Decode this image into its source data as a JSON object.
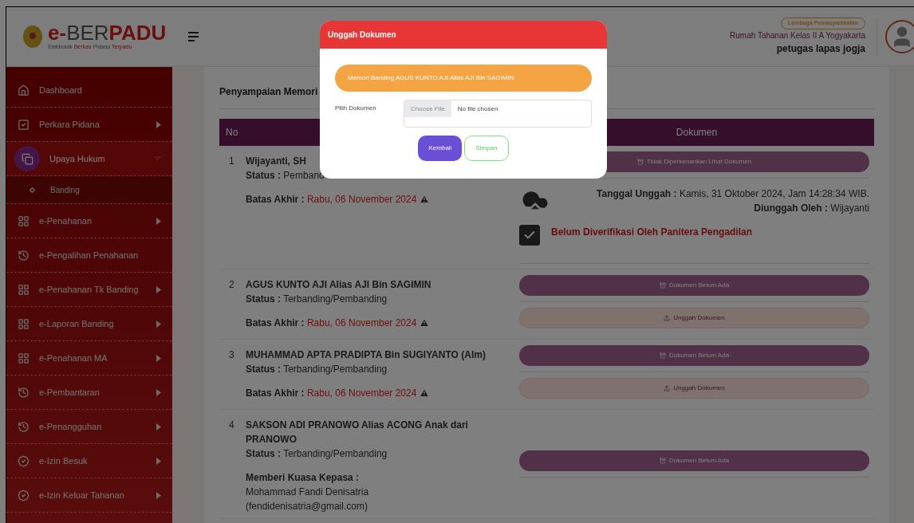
{
  "logo": {
    "title": [
      {
        "text": "e-",
        "kind": "accent"
      },
      {
        "text": "BER",
        "kind": "plain"
      },
      {
        "text": "PADU",
        "kind": "accent"
      }
    ],
    "subtitle": [
      {
        "text": "Elektronik ",
        "kind": "plain"
      },
      {
        "text": "Berkas ",
        "kind": "accent"
      },
      {
        "text": "Pidana ",
        "kind": "plain"
      },
      {
        "text": "Terpadu",
        "kind": "accent"
      }
    ]
  },
  "header": {
    "badge": "Lembaga Pemasyarakatan",
    "institution": "Rumah Tahanan Kelas II A Yogyakarta",
    "user": "petugas lapas jogja"
  },
  "sidebar": {
    "items": [
      {
        "label": "Dashboard",
        "kind": "home",
        "has_arrow": false,
        "selected": false
      },
      {
        "label": "Perkara Pidana",
        "kind": "check",
        "has_arrow": true,
        "selected": false
      },
      {
        "label": "Upaya Hukum",
        "kind": "copy",
        "has_arrow": true,
        "selected": true,
        "expanded": true,
        "children": [
          {
            "label": "Banding",
            "selected": false
          }
        ]
      },
      {
        "label": "e-Penahanan",
        "kind": "grid",
        "has_arrow": true,
        "selected": false
      },
      {
        "label": "e-Pengalihan Penahanan",
        "kind": "history",
        "has_arrow": false,
        "selected": false
      },
      {
        "label": "e-Penahanan Tk Banding",
        "kind": "grid",
        "has_arrow": true,
        "selected": false
      },
      {
        "label": "e-Laporan Banding",
        "kind": "grid",
        "has_arrow": true,
        "selected": false
      },
      {
        "label": "e-Penahanan MA",
        "kind": "grid",
        "has_arrow": true,
        "selected": false
      },
      {
        "label": "e-Pembantaran",
        "kind": "history",
        "has_arrow": true,
        "selected": false
      },
      {
        "label": "e-Penangguhan",
        "kind": "history",
        "has_arrow": true,
        "selected": false
      },
      {
        "label": "e-Izin Besuk",
        "kind": "badge",
        "has_arrow": true,
        "selected": false
      },
      {
        "label": "e-Izin Keluar Tahanan",
        "kind": "badge",
        "has_arrow": true,
        "selected": false
      }
    ]
  },
  "page_title": "Penyampaian Memori",
  "table": {
    "columns": [
      "No",
      "Dokumen"
    ],
    "rows": [
      {
        "no": "1",
        "name": "Wijayanti, SH",
        "details": [
          {
            "kind": "status",
            "label": "Status :",
            "value": "Pemband"
          },
          {
            "kind": "deadline",
            "label": "Batas Akhir :",
            "value": "Rabu, 06 November 2024"
          }
        ],
        "documents": [
          {
            "kind": "view",
            "label": "Tidak Diperkenankan Lihat Dokumen"
          },
          {
            "kind": "upload_info",
            "date_label": "Tanggal Unggah :",
            "date": "Kamis, 31 Oktober 2024, Jam 14:28:34 WIB.",
            "by_label": "Diunggah Oleh :",
            "by": "Wijayanti"
          },
          {
            "kind": "verification",
            "label": "Belum Diverifikasi Oleh Panitera Pengadilan"
          }
        ]
      },
      {
        "no": "2",
        "name": "AGUS KUNTO AJI Alias AJI Bin SAGIMIN",
        "details": [
          {
            "kind": "status",
            "label": "Status :",
            "value": "Terbanding/Pembanding"
          },
          {
            "kind": "deadline",
            "label": "Batas Akhir :",
            "value": "Rabu, 06 November 2024"
          }
        ],
        "documents": [
          {
            "kind": "view",
            "label": "Dokumen Belum Ada"
          },
          {
            "kind": "upload",
            "label": "Unggah Dokumen"
          }
        ]
      },
      {
        "no": "3",
        "name": "MUHAMMAD APTA PRADIPTA Bin SUGIYANTO (Alm)",
        "details": [
          {
            "kind": "status",
            "label": "Status :",
            "value": "Terbanding/Pembanding"
          },
          {
            "kind": "deadline",
            "label": "Batas Akhir :",
            "value": "Rabu, 06 November 2024"
          }
        ],
        "documents": [
          {
            "kind": "view",
            "label": "Dokumen Belum Ada"
          },
          {
            "kind": "upload",
            "label": "Unggah Dokumen"
          }
        ]
      },
      {
        "no": "4",
        "name": "SAKSON ADI PRANOWO Alias ACONG Anak dari PRANOWO",
        "details": [
          {
            "kind": "status",
            "label": "Status :",
            "value": "Terbanding/Pembanding"
          },
          {
            "kind": "proxy",
            "label": "Memberi Kuasa Kepasa :",
            "value": "Mohammad Fandi Denisatria",
            "extra": "(fendidenisatria@gmail.com)"
          }
        ],
        "documents": [
          {
            "kind": "view",
            "label": "Dokumen Belum Ada"
          }
        ]
      }
    ]
  },
  "modal": {
    "title": "Unggah Dokumen",
    "banner": "Memori Banding AGUS KUNTO AJI Alias AJI Bin SAGIMIN",
    "field_label": "Pilih Dokumen",
    "file_button": "Choose File",
    "file_status": "No file chosen",
    "buttons": [
      {
        "label": "Kembali",
        "kind": "primary"
      },
      {
        "label": "Simpan",
        "kind": "outline"
      }
    ]
  }
}
